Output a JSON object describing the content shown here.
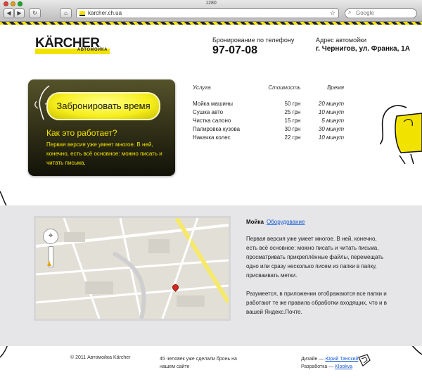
{
  "browser": {
    "window_title": "1280",
    "url": "karcher.ch.ua",
    "search_placeholder": "Google"
  },
  "header": {
    "logo_text": "KÄRCHER",
    "logo_sub": "АВТОМОЙКА",
    "phone_label": "Бронирование по телефону",
    "phone": "97-07-08",
    "address_label": "Адрес автомойки",
    "address": "г. Чернигов, ул. Франка, 1А"
  },
  "booking": {
    "button_label": "Забронировать время",
    "how_title": "Как это работает?",
    "how_text": "Первая версия уже умеет многое. В ней, конечно, есть всё основное: можно писать и читать письма,"
  },
  "prices": {
    "headers": [
      "Услуга",
      "Стоимость",
      "Время"
    ],
    "rows": [
      {
        "service": "Мойка машины",
        "price": "50 грн",
        "time": "20 минут"
      },
      {
        "service": "Сушка авто",
        "price": "25 грн",
        "time": "10 минут"
      },
      {
        "service": "Чистка салоно",
        "price": "15 грн",
        "time": "5 минут"
      },
      {
        "service": "Палировка кузова",
        "price": "30 грн",
        "time": "30 минут"
      },
      {
        "service": "Накачка колес",
        "price": "22 грн",
        "time": "10 минут"
      }
    ]
  },
  "info": {
    "tab_active": "Мойка",
    "tab_link": "Оборудование",
    "desc1": "Первая версия уже умеет многое. В ней, конечно, есть всё основное: можно писать и читать письма, просматривать прикреплённые файлы, перемещать одно или сразу несколько писем из папки в папку, присваивать метки.",
    "desc2": "Разумеется, в приложении отображаются все папки и работают те же правила обработки входящих, что и в вашей Яндекс.Почте."
  },
  "footer": {
    "copyright": "© 2011 Автомойка Kärcher",
    "counter": "45 человек уже сделали бронь на нашем сайте",
    "design_label": "Дизайн —",
    "design_name": "Юрий Танский",
    "dev_label": "Разработка —",
    "dev_name": "Klookva"
  },
  "colors": {
    "brand_yellow": "#f2e200",
    "card_dark": "#2f2e16",
    "link_blue": "#1a5bd6",
    "section_grey": "#e6e6e8"
  }
}
